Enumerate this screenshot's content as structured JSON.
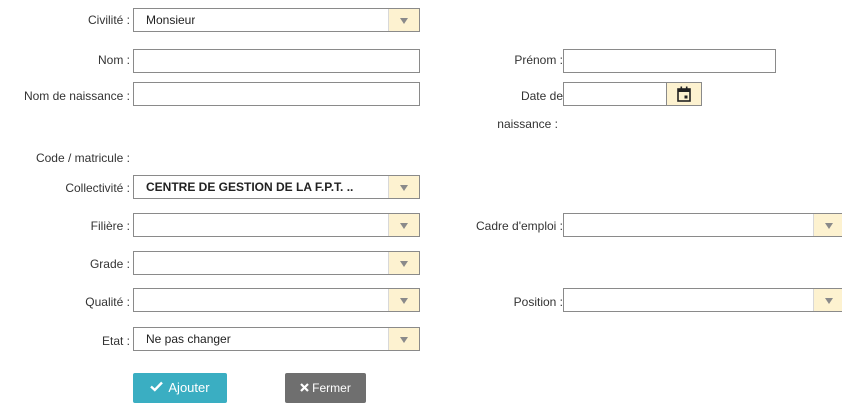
{
  "labels": {
    "civilite": "Civilité :",
    "nom": "Nom :",
    "prenom": "Prénom :",
    "nom_naissance": "Nom de naissance :",
    "date_naissance_1": "Date de",
    "date_naissance_2": "naissance :",
    "code_matricule": "Code / matricule :",
    "collectivite": "Collectivité :",
    "filiere": "Filière :",
    "cadre_emploi": "Cadre d'emploi :",
    "grade": "Grade :",
    "qualite": "Qualité :",
    "position": "Position :",
    "etat": "Etat :"
  },
  "fields": {
    "civilite": "Monsieur",
    "nom": "",
    "prenom": "",
    "nom_naissance": "",
    "date_naissance": "",
    "collectivite": "CENTRE DE GESTION DE LA F.P.T.   ..",
    "filiere": "",
    "cadre_emploi": "",
    "grade": "",
    "qualite": "",
    "position": "",
    "etat": "Ne pas changer"
  },
  "buttons": {
    "add": "Ajouter",
    "close": "Fermer"
  },
  "icons": {
    "calendar": "calendar-icon",
    "add": "check-icon",
    "close": "x-icon"
  },
  "colors": {
    "dropdown_bg": "#fdf2d0",
    "add_button": "#3aaec2",
    "close_button": "#6f6f6f"
  }
}
